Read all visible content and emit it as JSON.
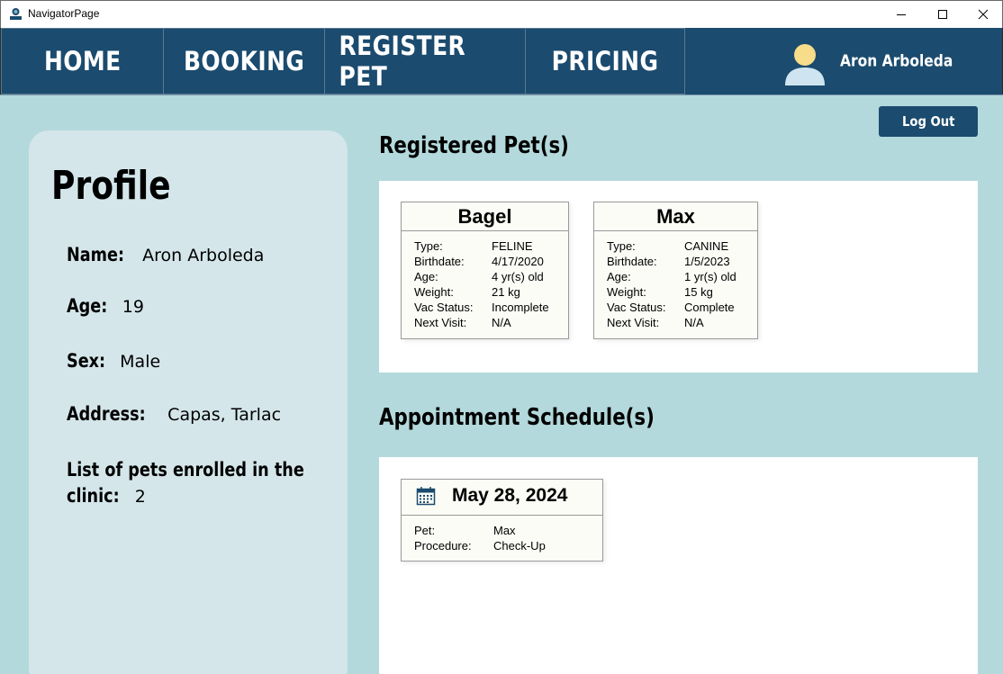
{
  "window": {
    "title": "NavigatorPage"
  },
  "nav": {
    "tabs": [
      {
        "label": "HOME"
      },
      {
        "label": "BOOKING"
      },
      {
        "label": "REGISTER PET"
      },
      {
        "label": "PRICING"
      }
    ],
    "user_name": "Aron Arboleda"
  },
  "logout_label": "Log Out",
  "profile": {
    "title": "Profile",
    "name_label": "Name:",
    "name": "Aron Arboleda",
    "age_label": "Age:",
    "age": "19",
    "sex_label": "Sex:",
    "sex": "Male",
    "address_label": "Address:",
    "address": "Capas, Tarlac",
    "pets_label_line1": "List of pets enrolled in the",
    "pets_label_line2": "clinic:",
    "pets_count": "2"
  },
  "registered_pets": {
    "heading": "Registered Pet(s)",
    "field_labels": {
      "type": "Type:",
      "birthdate": "Birthdate:",
      "age": "Age:",
      "weight": "Weight:",
      "vac_status": "Vac Status:",
      "next_visit": "Next Visit:"
    },
    "pets": [
      {
        "name": "Bagel",
        "type": "FELINE",
        "birthdate": "4/17/2020",
        "age": "4 yr(s) old",
        "weight": "21 kg",
        "vac_status": "Incomplete",
        "next_visit": "N/A"
      },
      {
        "name": "Max",
        "type": "CANINE",
        "birthdate": "1/5/2023",
        "age": "1 yr(s) old",
        "weight": "15 kg",
        "vac_status": "Complete",
        "next_visit": "N/A"
      }
    ]
  },
  "appointments": {
    "heading": "Appointment Schedule(s)",
    "field_labels": {
      "pet": "Pet:",
      "procedure": "Procedure:"
    },
    "items": [
      {
        "date": "May 28, 2024",
        "pet": "Max",
        "procedure": "Check-Up"
      }
    ]
  },
  "colors": {
    "nav": "#1b4b6e",
    "background": "#b3d9dc",
    "profile_card": "#d4e6ea",
    "panel": "#ffffff",
    "card": "#fbfcf6"
  },
  "icons": [
    "app-icon",
    "minimize-icon",
    "maximize-icon",
    "close-icon",
    "user-avatar-icon",
    "calendar-icon"
  ]
}
